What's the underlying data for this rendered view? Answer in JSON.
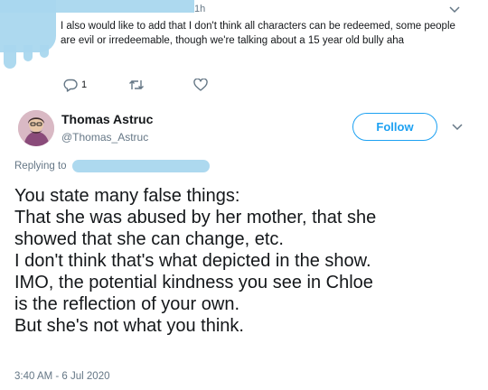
{
  "parent_tweet": {
    "time_ago": "1h",
    "text": "I also would like to add that I don't think all characters can be redeemed, some people are evil or irredeemable, though we're talking about a 15 year old bully aha",
    "reply_count": "1",
    "icons": {
      "reply": "reply-icon",
      "retweet": "retweet-icon",
      "like": "heart-icon",
      "menu": "chevron-down-icon"
    }
  },
  "author": {
    "name": "Thomas Astruc",
    "handle": "@Thomas_Astruc",
    "follow_label": "Follow"
  },
  "replying_to_label": "Replying to",
  "tweet": {
    "lines": [
      "You state many false things:",
      "That she was abused by her mother, that she",
      "showed that she can change, etc.",
      "I don't think that's what depicted in the show.",
      "IMO, the potential kindness you see in Chloe",
      "is the reflection of your own.",
      "But she's not what you think."
    ],
    "timestamp": "3:40 AM - 6 Jul 2020"
  },
  "colors": {
    "accent": "#1da1f2",
    "muted": "#657786",
    "text": "#14171a",
    "redaction": "#a9d7ee"
  }
}
